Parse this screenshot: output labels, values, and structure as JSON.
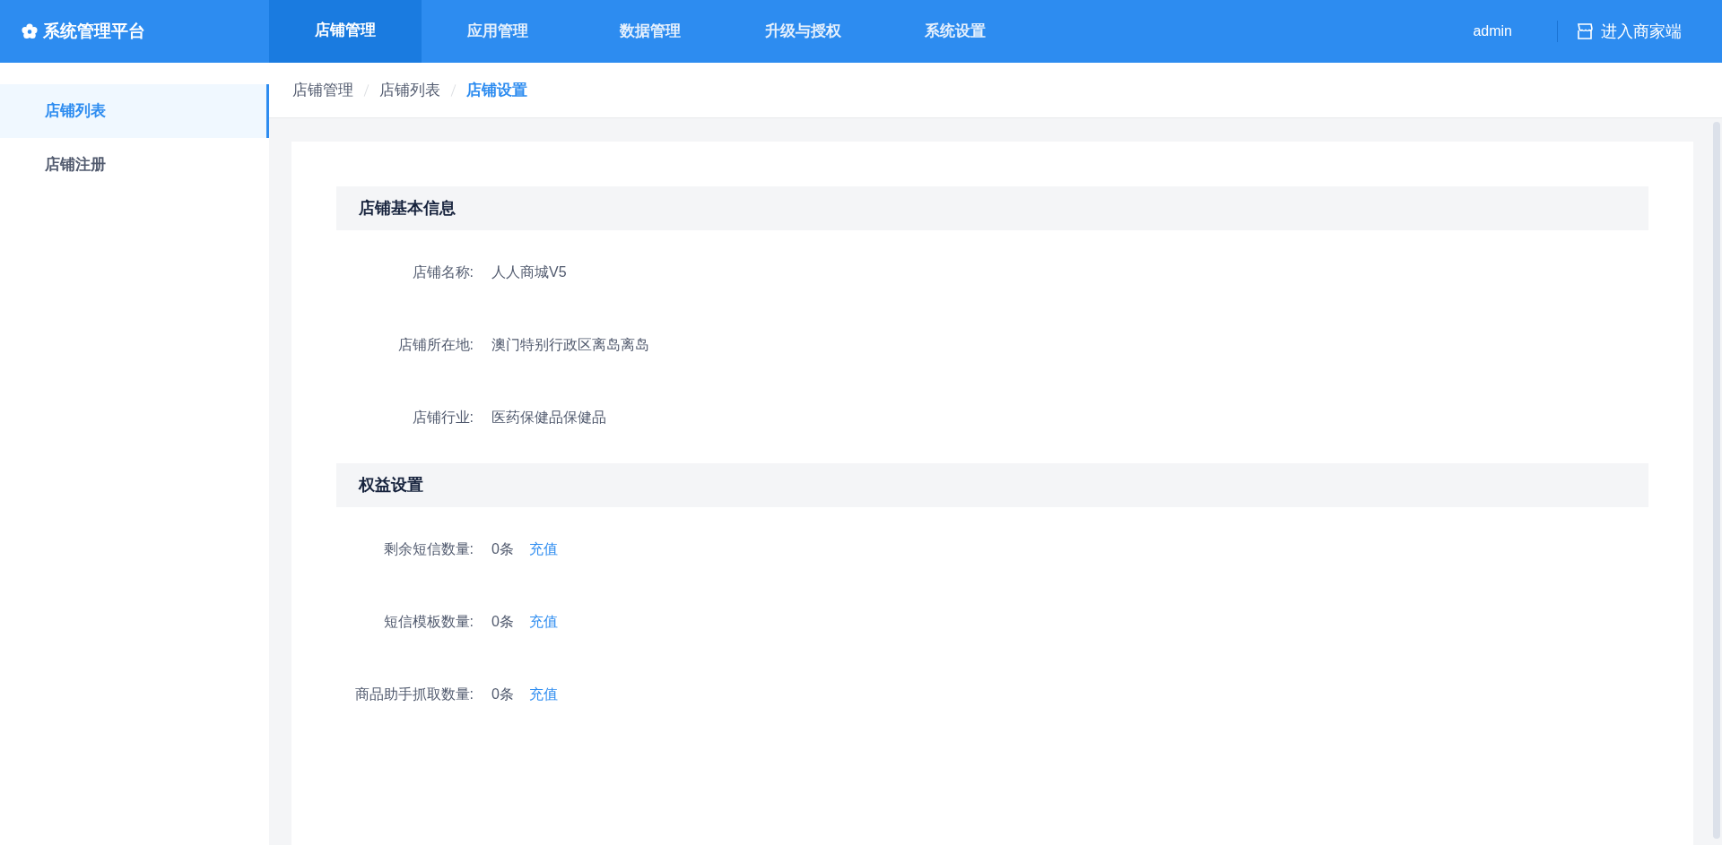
{
  "brand": {
    "title": "系统管理平台"
  },
  "nav": [
    {
      "label": "店铺管理",
      "selected": true
    },
    {
      "label": "应用管理",
      "selected": false
    },
    {
      "label": "数据管理",
      "selected": false
    },
    {
      "label": "升级与授权",
      "selected": false
    },
    {
      "label": "系统设置",
      "selected": false
    }
  ],
  "user": "admin",
  "merchant_link": "进入商家端",
  "sidebar": {
    "items": [
      {
        "label": "店铺列表",
        "selected": true
      },
      {
        "label": "店铺注册",
        "selected": false
      }
    ]
  },
  "breadcrumb": [
    "店铺管理",
    "店铺列表",
    "店铺设置"
  ],
  "sections": [
    {
      "title": "店铺基本信息",
      "rows": [
        {
          "label": "店铺名称:",
          "value": "人人商城V5"
        },
        {
          "label": "店铺所在地:",
          "value": "澳门特别行政区离岛离岛"
        },
        {
          "label": "店铺行业:",
          "value": "医药保健品保健品"
        }
      ]
    },
    {
      "title": "权益设置",
      "rows": [
        {
          "label": "剩余短信数量:",
          "value": "0条",
          "action": "充值"
        },
        {
          "label": "短信模板数量:",
          "value": "0条",
          "action": "充值"
        },
        {
          "label": "商品助手抓取数量:",
          "value": "0条",
          "action": "充值"
        }
      ]
    }
  ]
}
